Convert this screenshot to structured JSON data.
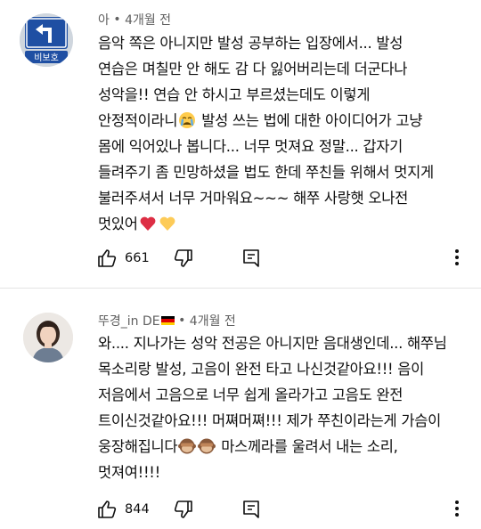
{
  "comments": [
    {
      "author": "아",
      "separator": "•",
      "time": "4개월 전",
      "avatar_sign_text": "비보호",
      "lines": [
        "음악 쪽은 아니지만 발성 공부하는 입장에서... 발성",
        "연습은 며칠만 안 해도 감 다 잃어버리는데 더군다나",
        "성악을!! 연습 안 하시고 부르셨는데도 이렇게",
        "안정적이라니",
        " 발성 쓰는 법에 대한 아이디어가 고냥",
        "몸에 익어있나 봅니다... 너무 멋져요 정말... 갑자기",
        "들려주기 좀 민망하셨을 법도 한데 쭈친들 위해서 멋지게",
        "불러주셔서 너무 거마워요~~~ 해쭈 사랑햇 오나전",
        "멋있어"
      ],
      "likes": "661"
    },
    {
      "author": "뚜경_in DE",
      "separator": "•",
      "time": "4개월 전",
      "lines": [
        "와.... 지나가는 성악 전공은 아니지만 음대생인데... 해쭈님",
        "목소리랑 발성, 고음이 완전 타고 나신것같아요!!! 음이",
        "저음에서 고음으로 너무 쉽게 올라가고 고음도 완전",
        "트이신것같아요!!! 머쪄머쪄!!! 제가 쭈친이라는게 가슴이",
        "웅장해집니다",
        " 마스께라를 울려서 내는 소리,",
        "멋져여!!!!"
      ],
      "likes": "844"
    }
  ],
  "colors": {
    "text": "#0f0f0f",
    "meta": "#606060",
    "divider": "#e3e3e3",
    "sign_blue": "#1f4fa3"
  },
  "icons": [
    "thumbs-up-icon",
    "thumbs-down-icon",
    "reply-icon",
    "more-vert-icon",
    "crying-face-emoji",
    "red-heart-emoji",
    "yellow-heart-emoji",
    "see-no-evil-monkey-emoji",
    "german-flag-icon"
  ]
}
